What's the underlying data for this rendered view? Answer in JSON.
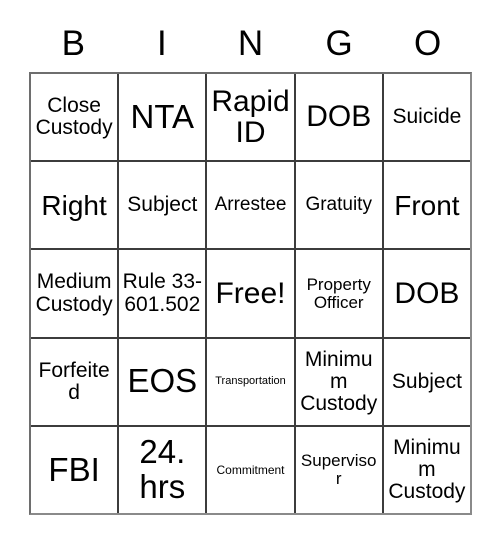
{
  "card": {
    "header_letters": [
      "B",
      "I",
      "N",
      "G",
      "O"
    ],
    "colors": {
      "background": "#ffffff",
      "text": "#000000",
      "grid_line": "#3c3c3c",
      "outer_border": "#7c7c7c"
    },
    "rows": [
      [
        {
          "text": "Close Custody",
          "size": "fs-md"
        },
        {
          "text": "NTA",
          "size": "fs-xxl"
        },
        {
          "text": "Rapid ID",
          "size": "fs-xl"
        },
        {
          "text": "DOB",
          "size": "fs-xl"
        },
        {
          "text": "Suicide",
          "size": "fs-md"
        }
      ],
      [
        {
          "text": "Right",
          "size": "fs-lg"
        },
        {
          "text": "Subject",
          "size": "fs-md"
        },
        {
          "text": "Arrestee",
          "size": "fs-sm"
        },
        {
          "text": "Gratuity",
          "size": "fs-sm"
        },
        {
          "text": "Front",
          "size": "fs-lg"
        }
      ],
      [
        {
          "text": "Medium Custody",
          "size": "fs-md"
        },
        {
          "text": "Rule 33-601.502",
          "size": "fs-md"
        },
        {
          "text": "Free!",
          "size": "fs-xl"
        },
        {
          "text": "Property Officer",
          "size": "fs-xs"
        },
        {
          "text": "DOB",
          "size": "fs-xl"
        }
      ],
      [
        {
          "text": "Forfeited",
          "size": "fs-md"
        },
        {
          "text": "EOS",
          "size": "fs-xxl"
        },
        {
          "text": "Transportation",
          "size": "fs-tiny"
        },
        {
          "text": "Minimum Custody",
          "size": "fs-md"
        },
        {
          "text": "Subject",
          "size": "fs-md"
        }
      ],
      [
        {
          "text": "FBI",
          "size": "fs-xxl"
        },
        {
          "text": "24. hrs",
          "size": "fs-xxl"
        },
        {
          "text": "Commitment",
          "size": "fs-xxs"
        },
        {
          "text": "Supervisor",
          "size": "fs-xs"
        },
        {
          "text": "Minimum Custody",
          "size": "fs-md"
        }
      ]
    ]
  }
}
